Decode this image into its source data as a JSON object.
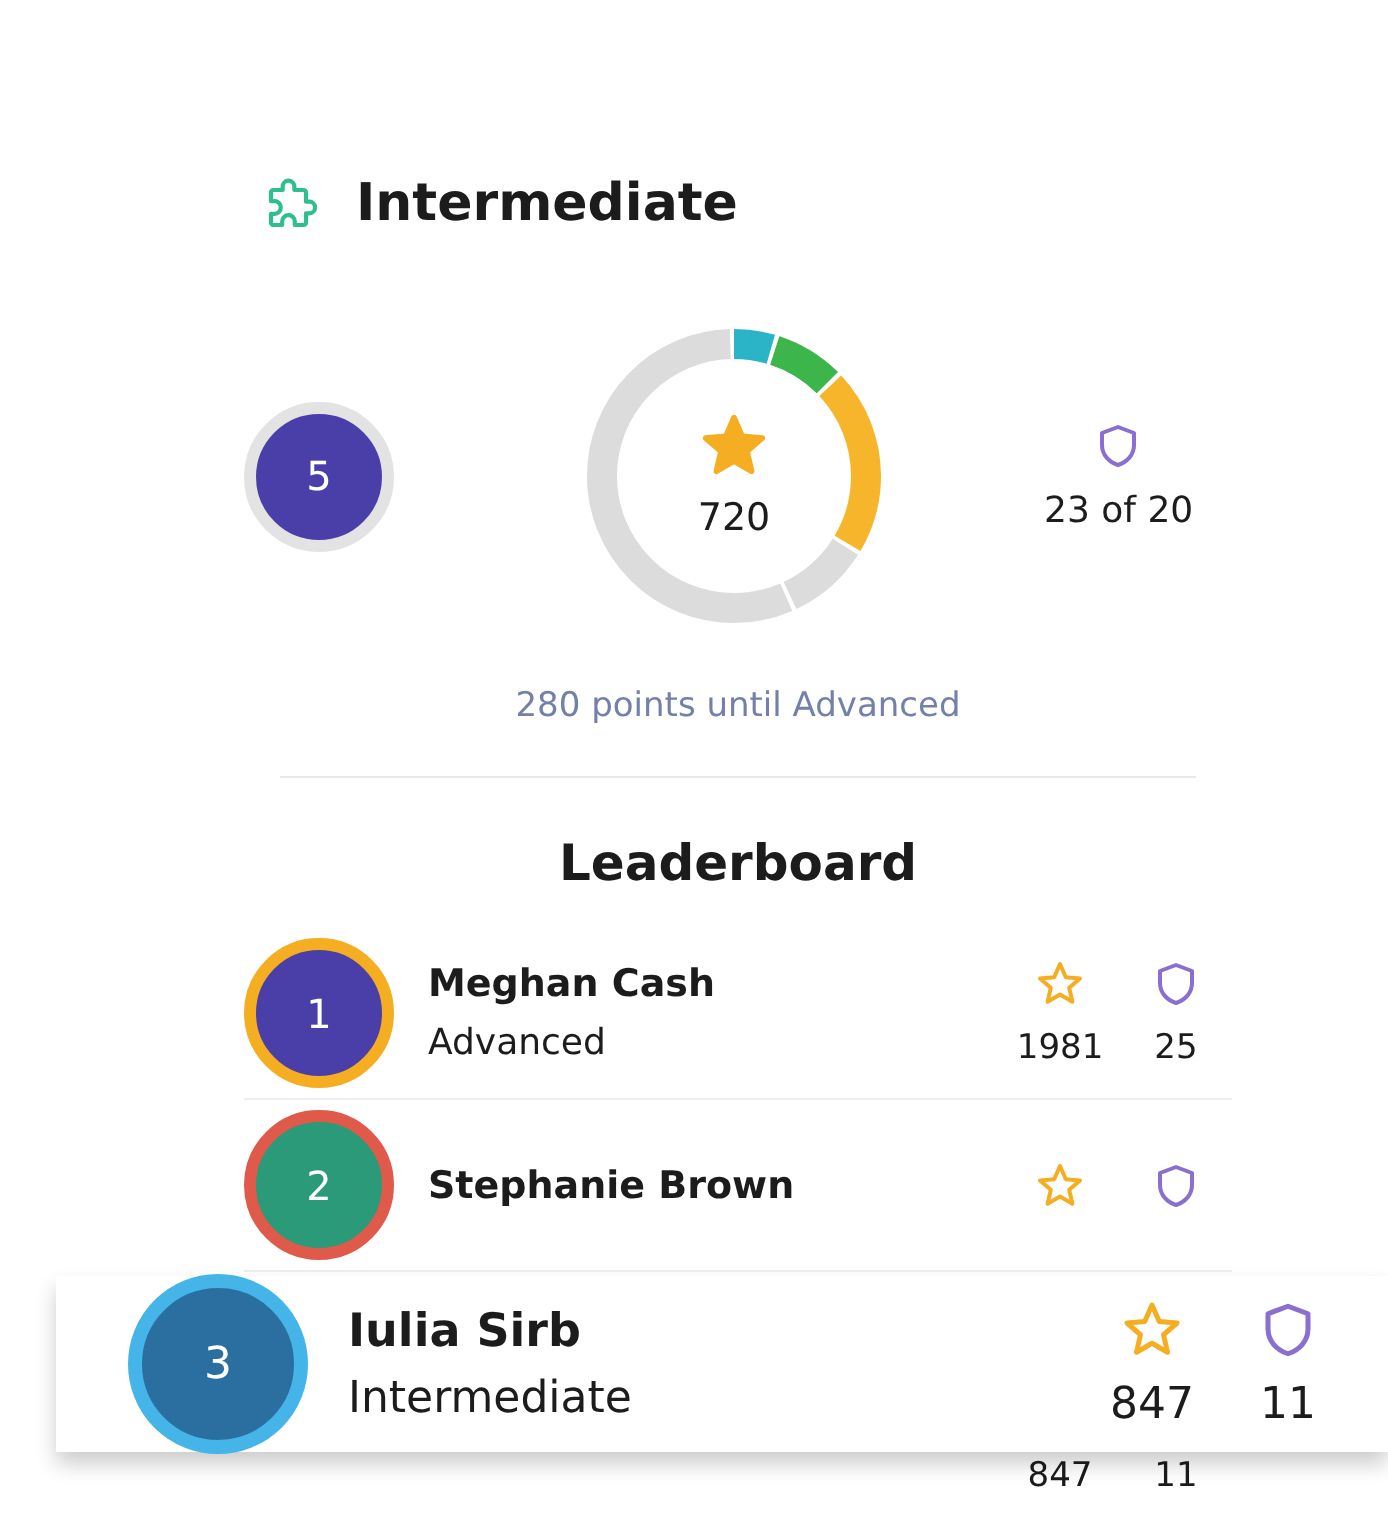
{
  "header": {
    "title": "Intermediate"
  },
  "progress": {
    "rank": "5",
    "points": "720",
    "badges": "23 of 20",
    "caption": "280 points until Advanced"
  },
  "leaderboard": {
    "title": "Leaderboard",
    "rows": [
      {
        "rank": "1",
        "name": "Meghan Cash",
        "tier": "Advanced",
        "points": "1981",
        "badges": "25",
        "color": "#f5ad22"
      },
      {
        "rank": "2",
        "name": "Stephanie Brown",
        "color": "#e05a4b"
      },
      {
        "points": "847",
        "badges": "11"
      }
    ]
  },
  "highlight": {
    "rank": "3",
    "name": "Iulia Sirb",
    "tier": "Intermediate",
    "points": "847",
    "badges": "11",
    "color": "#45b4e8"
  }
}
